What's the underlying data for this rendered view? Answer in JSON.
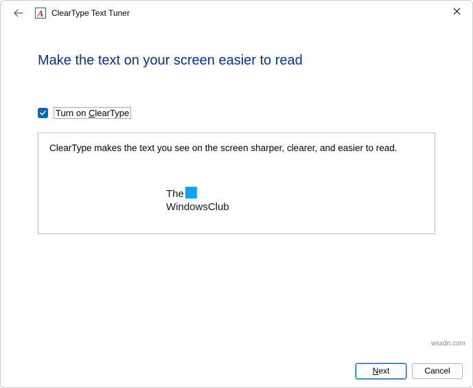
{
  "window": {
    "title": "ClearType Text Tuner"
  },
  "main": {
    "heading": "Make the text on your screen easier to read",
    "checkbox_label_pre": "Turn on ",
    "checkbox_label_accel": "C",
    "checkbox_label_post": "learType",
    "sample_text": "ClearType makes the text you see on the screen sharper, clearer, and easier to read.",
    "watermark_line1": "The",
    "watermark_line2": "WindowsClub"
  },
  "footer": {
    "next_pre": "",
    "next_accel": "N",
    "next_post": "ext",
    "cancel": "Cancel"
  },
  "source": "wsxdn.com"
}
